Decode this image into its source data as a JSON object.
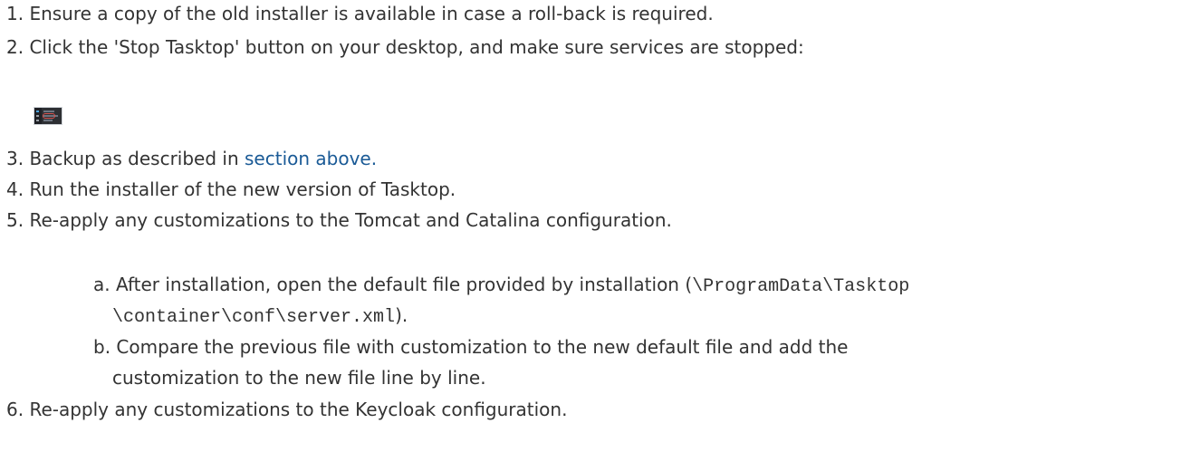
{
  "steps": [
    {
      "num": "1.",
      "text": "Ensure a copy of the old installer is available in case a roll-back is required."
    },
    {
      "num": "2.",
      "text": "Click the 'Stop Tasktop' button on your desktop, and make sure services are stopped:"
    },
    {
      "num": "3.",
      "text_before": "Backup as described in ",
      "link": "section above.",
      "text_after": ""
    },
    {
      "num": "4.",
      "text": "Run the installer of the new version of Tasktop."
    },
    {
      "num": "5.",
      "text": "Re-apply any customizations to the Tomcat and Catalina configuration."
    },
    {
      "num": "6.",
      "text": "Re-apply any customizations to the Keycloak configuration."
    }
  ],
  "substeps": {
    "a": {
      "letter": "a.",
      "text_before": "After installation, open the default file provided by installation (",
      "code_line1": "\\ProgramData\\Tasktop",
      "code_line2": "\\container\\conf\\server.xml",
      "text_after": ")."
    },
    "b": {
      "letter": "b.",
      "line1": "Compare the previous file with customization to the new default file and add the",
      "line2": "customization to the new file line by line."
    }
  },
  "screenshot_thumbnail": {
    "icon": "tasktop-stop-screenshot-icon"
  }
}
